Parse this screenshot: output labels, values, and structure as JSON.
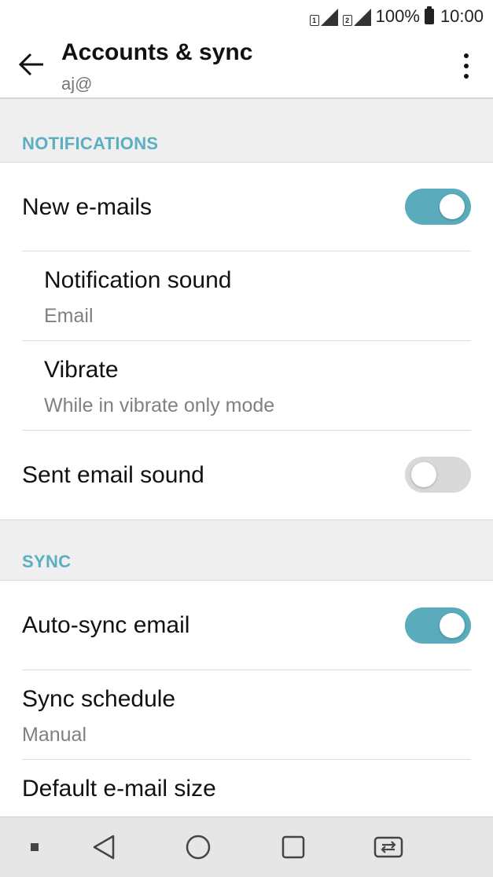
{
  "status_bar": {
    "sim1_label": "1",
    "sim2_label": "2",
    "battery_percent": "100%",
    "time": "10:00"
  },
  "app_bar": {
    "title": "Accounts & sync",
    "subtitle": "aj@"
  },
  "notifications_section": {
    "header": "NOTIFICATIONS",
    "new_emails": {
      "label": "New e-mails",
      "toggle_on": true
    },
    "notification_sound": {
      "label": "Notification sound",
      "value": "Email"
    },
    "vibrate": {
      "label": "Vibrate",
      "value": "While in vibrate only mode"
    },
    "sent_email_sound": {
      "label": "Sent email sound",
      "toggle_on": false
    }
  },
  "sync_section": {
    "header": "SYNC",
    "auto_sync": {
      "label": "Auto-sync email",
      "toggle_on": true
    },
    "sync_schedule": {
      "label": "Sync schedule",
      "value": "Manual"
    },
    "default_email_size": {
      "label": "Default e-mail size"
    }
  },
  "colors": {
    "accent": "#5ab0c1",
    "toggle_on": "#5aacbd",
    "toggle_off": "#d9d9d9",
    "section_bg": "#efefef",
    "nav_bg": "#e6e6e6"
  },
  "nav_bar": {
    "icons": [
      "dot-icon",
      "back-triangle-icon",
      "home-circle-icon",
      "recents-square-icon",
      "dual-window-icon"
    ]
  }
}
